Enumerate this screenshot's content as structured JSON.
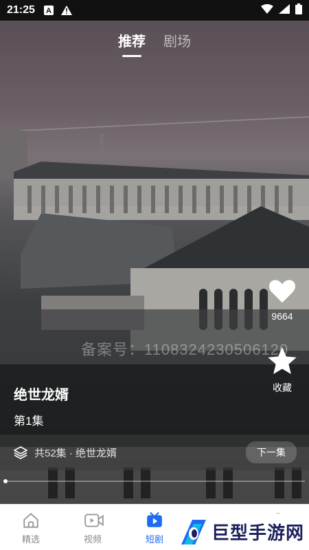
{
  "status_bar": {
    "time": "21:25",
    "left_icons": [
      "a-notification-icon",
      "warning-icon"
    ],
    "right_icons": [
      "wifi-icon",
      "signal-icon",
      "battery-icon"
    ]
  },
  "top_tabs": [
    {
      "label": "推荐",
      "active": true
    },
    {
      "label": "剧场",
      "active": false
    }
  ],
  "watermark": "备案号：1108324230506120",
  "actions": {
    "like_count": "9664",
    "favorite_label": "收藏"
  },
  "drama": {
    "title": "绝世龙婿",
    "episode": "第1集",
    "series_info": "共52集 · 绝世龙婿",
    "next_label": "下一集"
  },
  "progress": 0.0,
  "bottom_nav": [
    {
      "label": "精选",
      "icon": "home-icon",
      "active": false
    },
    {
      "label": "视频",
      "icon": "video-icon",
      "active": false
    },
    {
      "label": "短剧",
      "icon": "tv-icon",
      "active": true
    },
    {
      "label": "",
      "icon": "grid-icon",
      "active": false
    },
    {
      "label": "",
      "icon": "profile-icon",
      "active": false
    }
  ],
  "site_logo_text": "巨型手游网",
  "colors": {
    "accent": "#1e6cf2",
    "logo_text": "#1b1f5a"
  }
}
